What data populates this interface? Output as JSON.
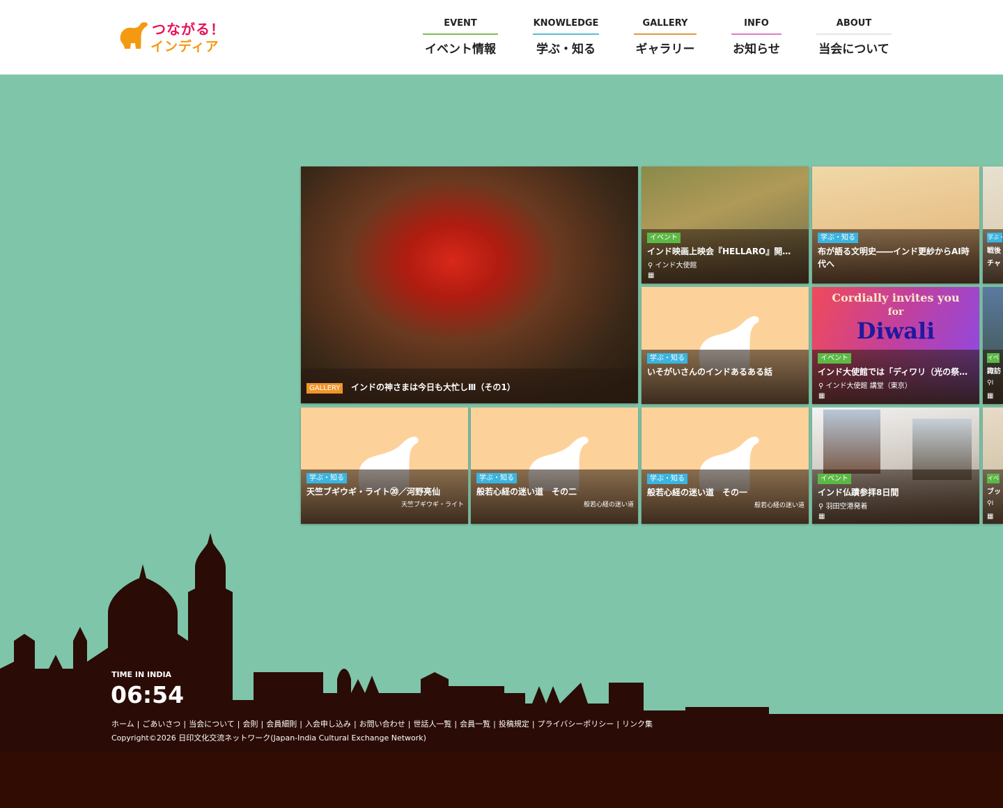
{
  "logo": {
    "line1": "つながる！",
    "line2": "インディア"
  },
  "nav": [
    {
      "en": "EVENT",
      "jp": "イベント情報",
      "color": "#7cbf5a"
    },
    {
      "en": "KNOWLEDGE",
      "jp": "学ぶ・知る",
      "color": "#5bbcd6"
    },
    {
      "en": "GALLERY",
      "jp": "ギャラリー",
      "color": "#e09a3c"
    },
    {
      "en": "INFO",
      "jp": "お知らせ",
      "color": "#e07cbf"
    },
    {
      "en": "ABOUT",
      "jp": "当会について",
      "color": "#e6e6e6"
    }
  ],
  "cards": [
    {
      "badge": "GALLERY",
      "title": "インドの神さまは今日も大忙しⅢ（その1）"
    },
    {
      "badge": "イベント",
      "title": "インド映画上映会『HELLARO』開…",
      "location": "インド大使館"
    },
    {
      "badge": "学ぶ・知る",
      "title": "布が語る文明史――インド更紗からAI時代へ"
    },
    {
      "badge": "学ぶ・知る",
      "title": "戦後",
      "title2": "チャ"
    },
    {
      "badge": "学ぶ・知る",
      "title": "いそがいさんのインドあるある話"
    },
    {
      "badge": "イベント",
      "title": "インド大使館では「ディワリ（光の祭典…",
      "location": "インド大使館 講堂（東京）"
    },
    {
      "badge": "イベ",
      "title": "諏訪",
      "location": "I"
    },
    {
      "badge": "学ぶ・知る",
      "title": "天竺ブギウギ・ライト⑳／河野亮仙",
      "series": "天竺ブギウギ・ライト"
    },
    {
      "badge": "学ぶ・知る",
      "title": "般若心経の迷い道　その二",
      "series": "般若心経の迷い道"
    },
    {
      "badge": "学ぶ・知る",
      "title": "般若心経の迷い道　その一",
      "series": "般若心経の迷い道"
    },
    {
      "badge": "イベント",
      "title": "インド仏蹟参拝8日間",
      "location": "羽田空港発着"
    },
    {
      "badge": "イベ",
      "title": "ブッ",
      "location": "I"
    }
  ],
  "footer": {
    "time_label": "TIME IN INDIA",
    "time": "06:54",
    "links": [
      "ホーム",
      "ごあいさつ",
      "当会について",
      "会則",
      "会員細則",
      "入会申し込み",
      "お問い合わせ",
      "世話人一覧",
      "会員一覧",
      "投稿規定",
      "プライバシーポリシー",
      "リンク集"
    ],
    "copyright": "Copyright©2026 日印文化交流ネットワーク(Japan-India Cultural Exchange Network)"
  },
  "colors": {
    "background": "#7fc5a9",
    "footer": "#2a0b05",
    "learn_badge": "#3bb4e0",
    "event_badge": "#5cb946",
    "gallery_badge": "#f0952a"
  }
}
